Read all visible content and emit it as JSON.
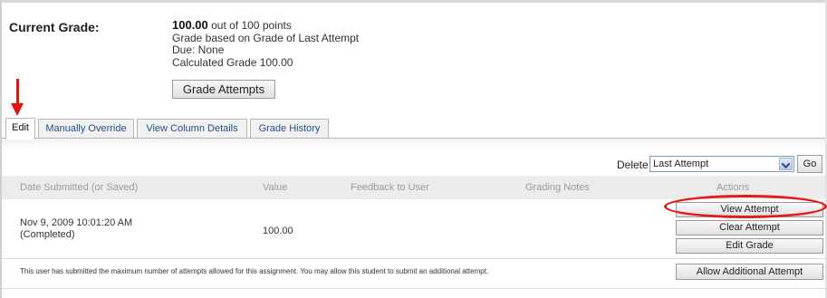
{
  "grade": {
    "label": "Current Grade:",
    "score": "100.00",
    "score_suffix": " out of 100 points",
    "based_on": "Grade based on Grade of Last Attempt",
    "due": "Due: None",
    "calculated": "Calculated Grade  100.00",
    "attempts_button": "Grade Attempts"
  },
  "tabs": [
    "Edit",
    "Manually Override",
    "View Column Details",
    "Grade History"
  ],
  "active_tab": "Edit",
  "delete_control": {
    "label": "Delete",
    "selected": "Last Attempt",
    "go_label": "Go"
  },
  "table": {
    "headers": [
      "Date Submitted (or Saved)",
      "Value",
      "Feedback to User",
      "Grading Notes",
      "Actions"
    ],
    "rows": [
      {
        "date": "Nov 9, 2009 10:01:20 AM",
        "status": "(Completed)",
        "value": "100.00",
        "actions": [
          "View Attempt",
          "Clear Attempt",
          "Edit Grade"
        ]
      }
    ]
  },
  "footer": {
    "note": "This user has submitted the maximum number of attempts allowed for this assignment. You may allow this student to submit an additional attempt.",
    "allow_button": "Allow Additional Attempt"
  },
  "annotations": {
    "color": "#e1150f"
  }
}
